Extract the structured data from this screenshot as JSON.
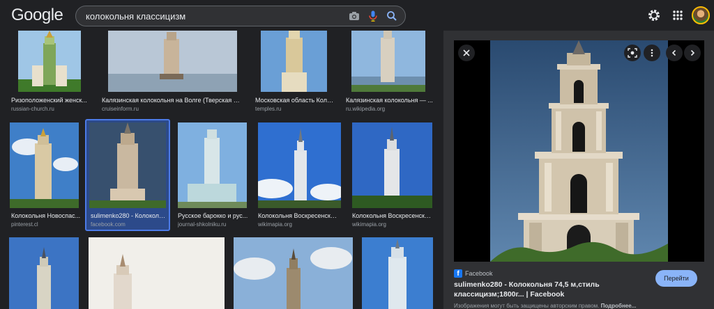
{
  "logo": "Google",
  "search": {
    "query": "колокольня классицизм"
  },
  "icons": {
    "camera": "camera-icon",
    "mic": "mic-icon",
    "search": "search-icon",
    "settings": "gear-icon",
    "apps": "apps-grid-icon"
  },
  "results": [
    {
      "title": "Ризоположенский женск...",
      "source": "russian-church.ru"
    },
    {
      "title": "Калязинская колокольня на Волге (Тверская об...",
      "source": "cruiseinform.ru"
    },
    {
      "title": "Московская область Коло...",
      "source": "temples.ru"
    },
    {
      "title": "Калязинская колокольня — ...",
      "source": "ru.wikipedia.org"
    },
    {
      "title": "Колокольня Новоспас...",
      "source": "pinterest.cl"
    },
    {
      "title": "sulimenko280 - Колоколь...",
      "source": "facebook.com"
    },
    {
      "title": "Русское барокко и рус...",
      "source": "journal-shkolniku.ru"
    },
    {
      "title": "Колокольня Воскресенског...",
      "source": "wikimapia.org"
    },
    {
      "title": "Колокольня Воскресенско...",
      "source": "wikimapia.org"
    }
  ],
  "panel": {
    "site": "Facebook",
    "title": "sulimenko280 - Колокольня 74,5 м,стиль классицизм;1800г... | Facebook",
    "visit_label": "Перейти",
    "note": "Изображения могут быть защищены авторским правом.",
    "note_more": "Подробнее..."
  },
  "colors": {
    "background": "#202124",
    "panel": "#303134",
    "accent": "#8ab4f8",
    "selection": "#4c7be8"
  }
}
